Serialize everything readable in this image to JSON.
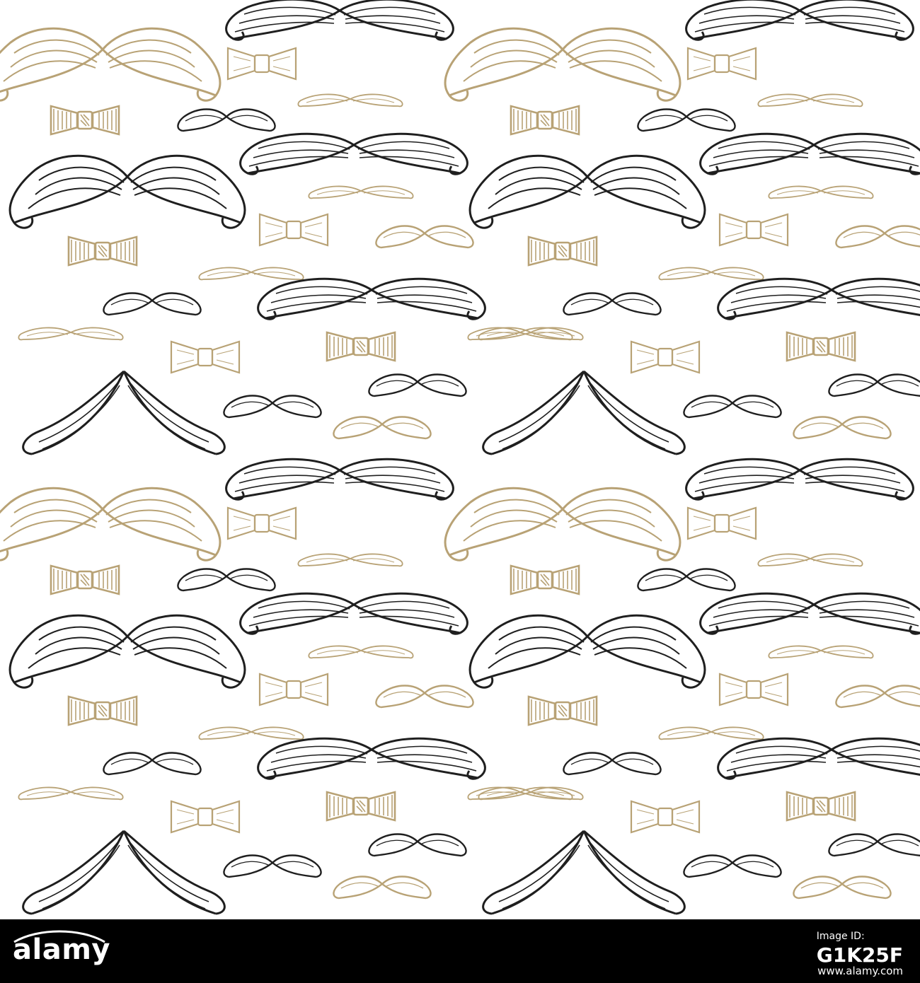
{
  "pattern": {
    "background_color": "#ffffff",
    "ink_color": "#1f1f1f",
    "gold_color": "#b8a275",
    "motifs": [
      "mustache-icon",
      "bow-tie-icon"
    ]
  },
  "footer": {
    "background_color": "#000000",
    "logo_text": "alamy",
    "image_id_label": "Image ID:",
    "image_id": "G1K25F",
    "site": "www.alamy.com"
  }
}
